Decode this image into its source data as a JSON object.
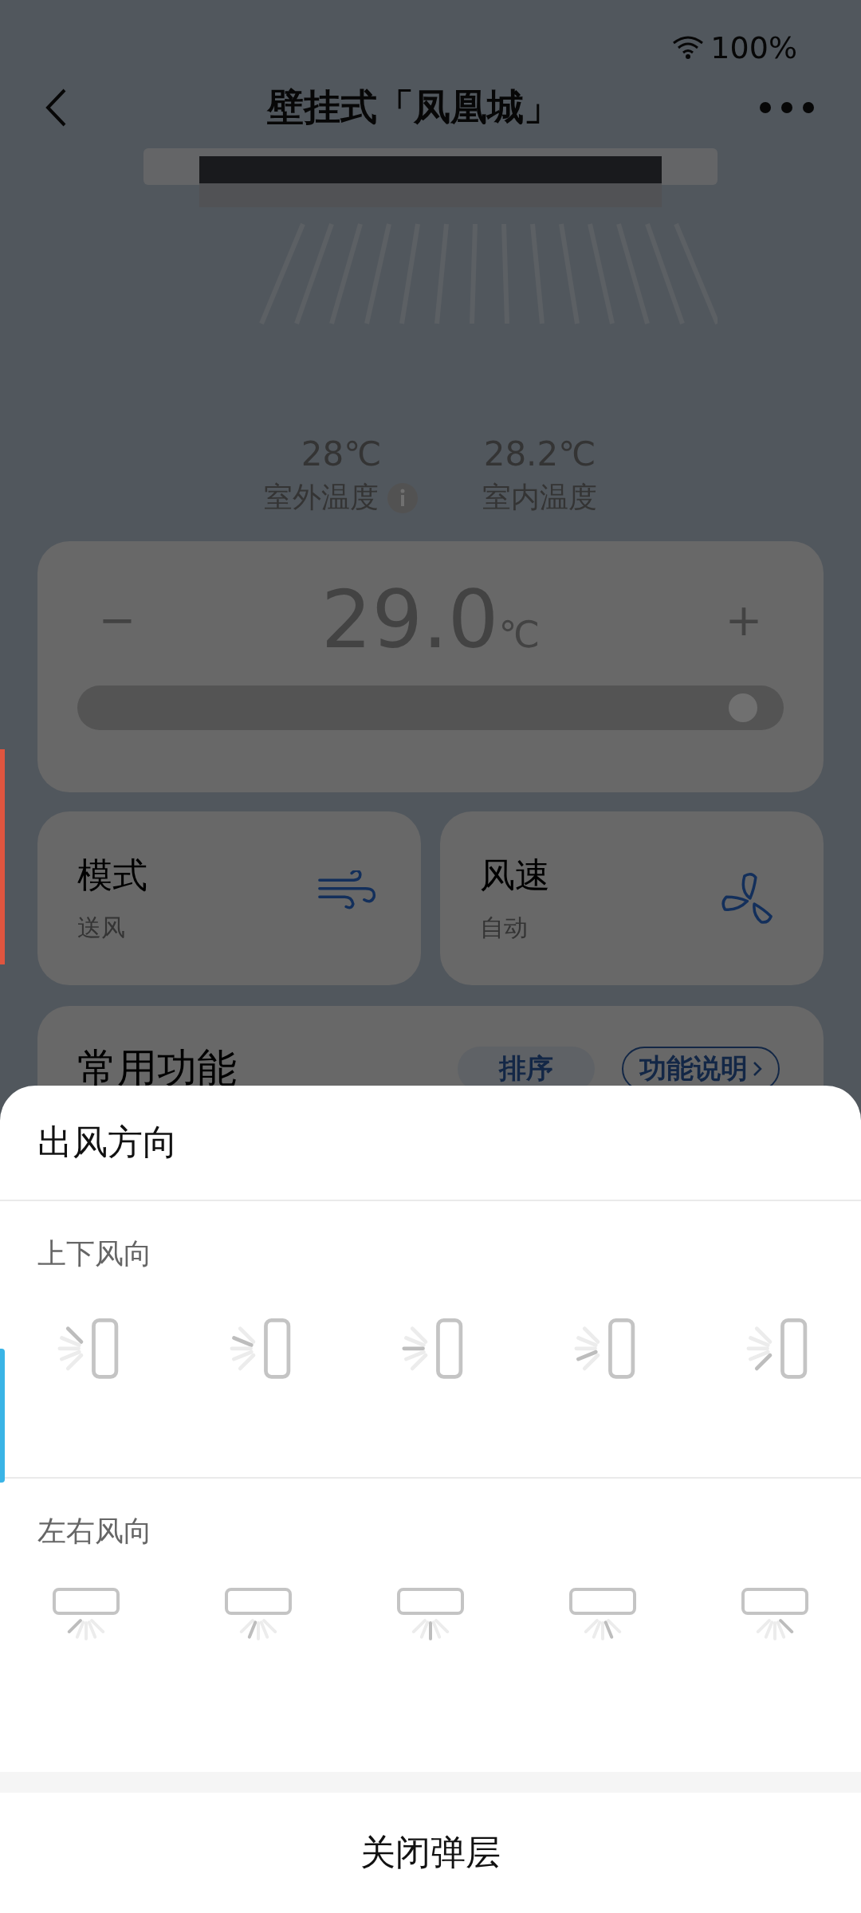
{
  "status_bar": {
    "battery": "100%"
  },
  "header": {
    "title": "壁挂式「凤凰城」"
  },
  "temperatures": [
    {
      "value": "28℃",
      "label": "室外温度",
      "info": true
    },
    {
      "value": "28.2℃",
      "label": "室内温度",
      "info": false
    }
  ],
  "thermostat": {
    "minus": "−",
    "value": "29.0",
    "unit": "℃",
    "plus": "+",
    "level": 0.97
  },
  "controls": [
    {
      "title": "模式",
      "value": "送风",
      "kind": "wind"
    },
    {
      "title": "风速",
      "value": "自动",
      "kind": "fan"
    }
  ],
  "functions": {
    "title": "常用功能",
    "buttons": [
      {
        "label": "排序",
        "kind": "filled"
      },
      {
        "label": "功能说明",
        "kind": "outlined"
      }
    ]
  },
  "sheet": {
    "title": "出风方向",
    "groups": [
      {
        "title": "上下风向",
        "kind": "vertical",
        "options": [
          {
            "selected": false
          },
          {
            "selected": false
          },
          {
            "selected": false
          },
          {
            "selected": false
          },
          {
            "selected": false
          }
        ]
      },
      {
        "title": "左右风向",
        "kind": "horizontal",
        "options": [
          {
            "selected": false
          },
          {
            "selected": false
          },
          {
            "selected": false
          },
          {
            "selected": false
          },
          {
            "selected": false
          }
        ]
      }
    ],
    "close": "关闭弹层"
  }
}
